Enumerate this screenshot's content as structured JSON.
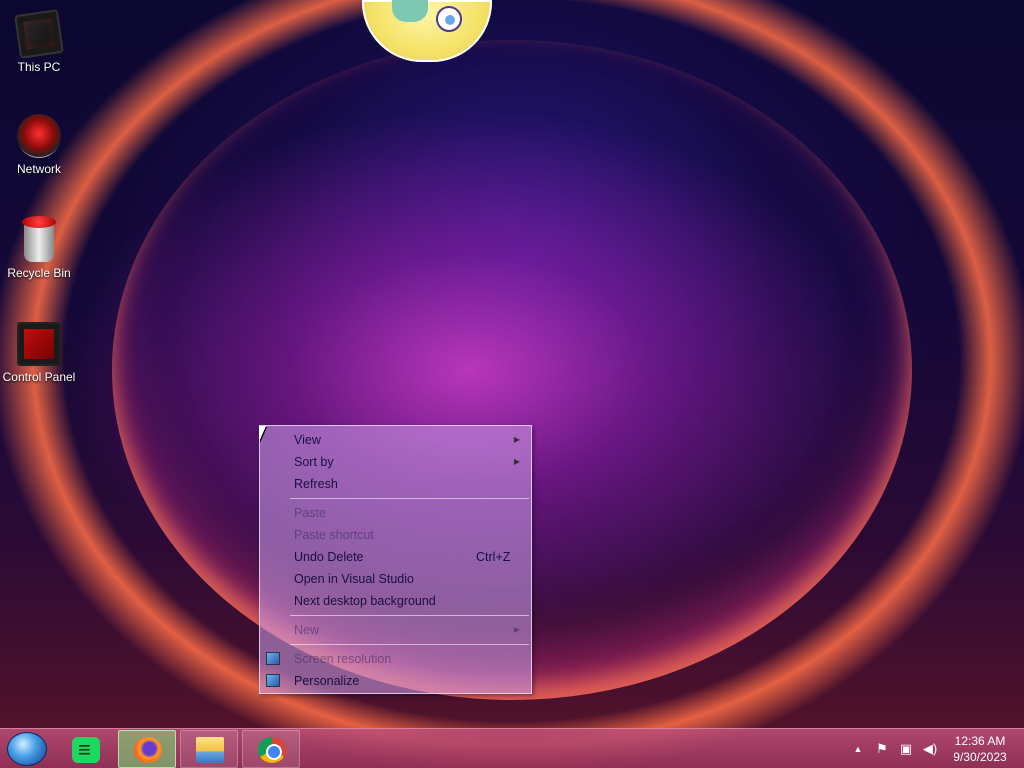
{
  "desktop": {
    "icons": [
      {
        "label": "This PC",
        "icon": "computer-icon"
      },
      {
        "label": "Network",
        "icon": "network-icon"
      },
      {
        "label": "Recycle Bin",
        "icon": "recycle-bin-icon"
      },
      {
        "label": "Control Panel",
        "icon": "control-panel-icon"
      }
    ]
  },
  "context_menu": {
    "items": [
      {
        "label": "View",
        "submenu": true,
        "enabled": true
      },
      {
        "label": "Sort by",
        "submenu": true,
        "enabled": true
      },
      {
        "label": "Refresh",
        "enabled": true
      },
      {
        "label": "Paste",
        "enabled": false
      },
      {
        "label": "Paste shortcut",
        "enabled": false
      },
      {
        "label": "Undo Delete",
        "shortcut": "Ctrl+Z",
        "enabled": true
      },
      {
        "label": "Open in Visual Studio",
        "enabled": true
      },
      {
        "label": "Next desktop background",
        "enabled": true
      },
      {
        "label": "New",
        "submenu": true,
        "enabled": false
      },
      {
        "label": "Screen resolution",
        "icon": "display-settings-icon",
        "enabled": false
      },
      {
        "label": "Personalize",
        "icon": "personalize-icon",
        "enabled": true
      }
    ]
  },
  "taskbar": {
    "start_icon": "start-orb-icon",
    "pinned": [
      {
        "app": "Spotify",
        "icon": "spotify-icon",
        "active": false
      },
      {
        "app": "Firefox",
        "icon": "firefox-icon",
        "active": true
      },
      {
        "app": "File Explorer",
        "icon": "folder-icon",
        "active": false
      },
      {
        "app": "Chrome",
        "icon": "chrome-icon",
        "active": false
      }
    ],
    "tray": {
      "icons": [
        "show-hidden-icons-icon",
        "action-center-flag-icon",
        "network-status-icon",
        "volume-icon"
      ],
      "time": "12:36 AM",
      "date": "9/30/2023"
    }
  }
}
